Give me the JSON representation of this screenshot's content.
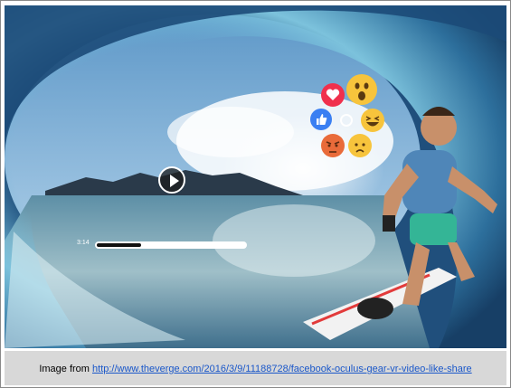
{
  "player": {
    "current_time": "3:14",
    "progress": 0.3
  },
  "reactions": [
    {
      "name": "love",
      "icon": "heart-icon",
      "color": "#f0304d"
    },
    {
      "name": "wow",
      "icon": "wow-face-icon",
      "color": "#f7c43c"
    },
    {
      "name": "like",
      "icon": "thumbs-up-icon",
      "color": "#3a7ff2"
    },
    {
      "name": "haha",
      "icon": "laugh-face-icon",
      "color": "#f7c43c"
    },
    {
      "name": "angry",
      "icon": "angry-face-icon",
      "color": "#e96b3a"
    },
    {
      "name": "sad",
      "icon": "sad-face-icon",
      "color": "#f7c43c"
    }
  ],
  "caption": {
    "prefix": "Image from ",
    "link_text": "http://www.theverge.com/2016/3/9/11188728/facebook-oculus-gear-vr-video-like-share"
  }
}
